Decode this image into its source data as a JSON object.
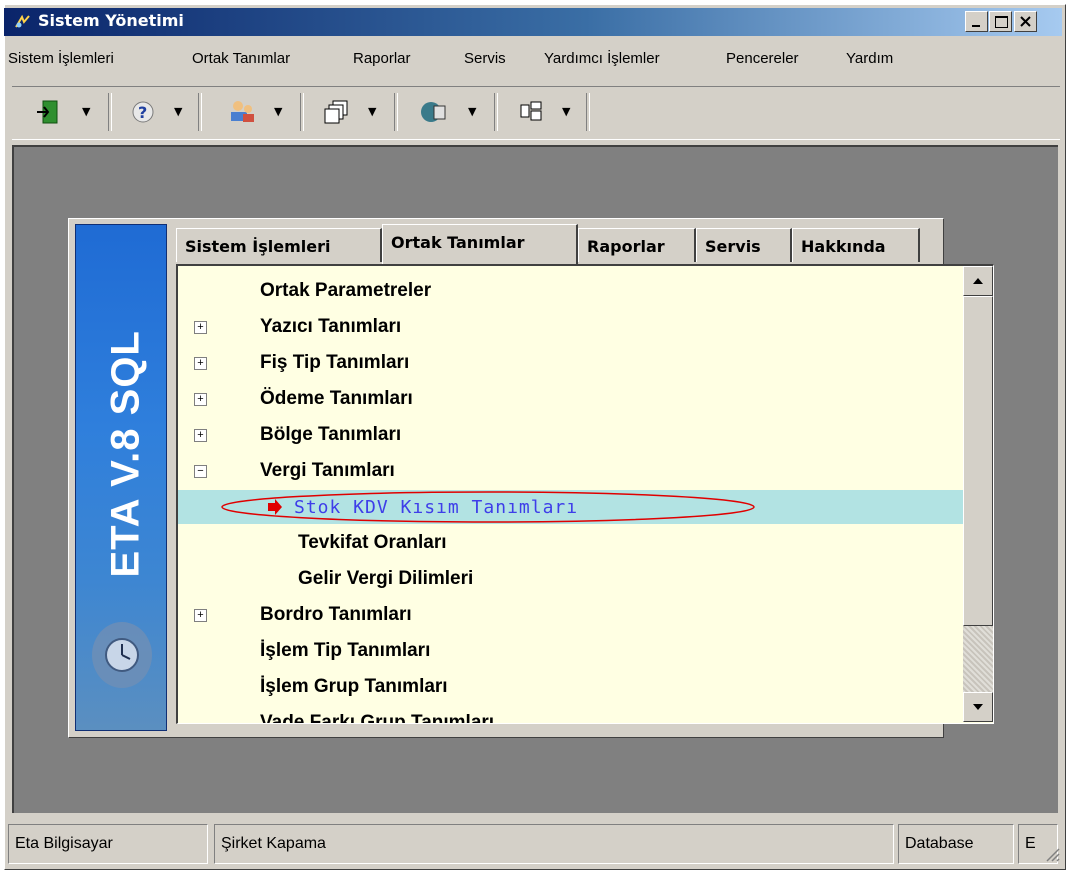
{
  "window": {
    "title": "Sistem Yönetimi",
    "minimize_icon": "minimize-icon",
    "maximize_icon": "maximize-icon",
    "close_icon": "close-icon"
  },
  "menu": [
    "Sistem İşlemleri",
    "Ortak Tanımlar",
    "Raporlar",
    "Servis",
    "Yardımcı İşlemler",
    "Pencereler",
    "Yardım"
  ],
  "toolbar": {
    "buttons": [
      "exit-icon",
      "help-icon",
      "users-icon",
      "windows-icon",
      "connection-icon",
      "layout-icon"
    ]
  },
  "logo": {
    "text": "ETA V.8 SQL"
  },
  "tabs": [
    "Sistem İşlemleri",
    "Ortak Tanımlar",
    "Raporlar",
    "Servis",
    "Hakkında"
  ],
  "tabs_active": "Ortak Tanımlar",
  "tree": [
    {
      "label": "Ortak Parametreler",
      "expander": ""
    },
    {
      "label": "Yazıcı Tanımları",
      "expander": "+"
    },
    {
      "label": "Fiş Tip Tanımları",
      "expander": "+"
    },
    {
      "label": "Ödeme Tanımları",
      "expander": "+"
    },
    {
      "label": "Bölge Tanımları",
      "expander": "+"
    },
    {
      "label": "Vergi Tanımları",
      "expander": "−"
    },
    {
      "label": "Stok KDV Kısım Tanımları",
      "expander": ""
    },
    {
      "label": "Tevkifat Oranları",
      "expander": ""
    },
    {
      "label": "Gelir Vergi Dilimleri",
      "expander": ""
    },
    {
      "label": "Bordro Tanımları",
      "expander": "+"
    },
    {
      "label": "İşlem Tip Tanımları",
      "expander": ""
    },
    {
      "label": "İşlem Grup Tanımları",
      "expander": ""
    },
    {
      "label": "Vade Farkı Grup Tanımları",
      "expander": ""
    }
  ],
  "scroll": {
    "up_icon": "scroll-up-icon",
    "down_icon": "scroll-down-icon",
    "position": 0
  },
  "status": [
    "Eta Bilgisayar",
    "Şirket Kapama",
    "Database",
    "E"
  ],
  "colors": {
    "title_start": "#0a246a",
    "tree_background": "#ffffe3",
    "selection": "#b2e3e3",
    "selected_text": "#3e3ee9",
    "annotation": "#e00000"
  }
}
